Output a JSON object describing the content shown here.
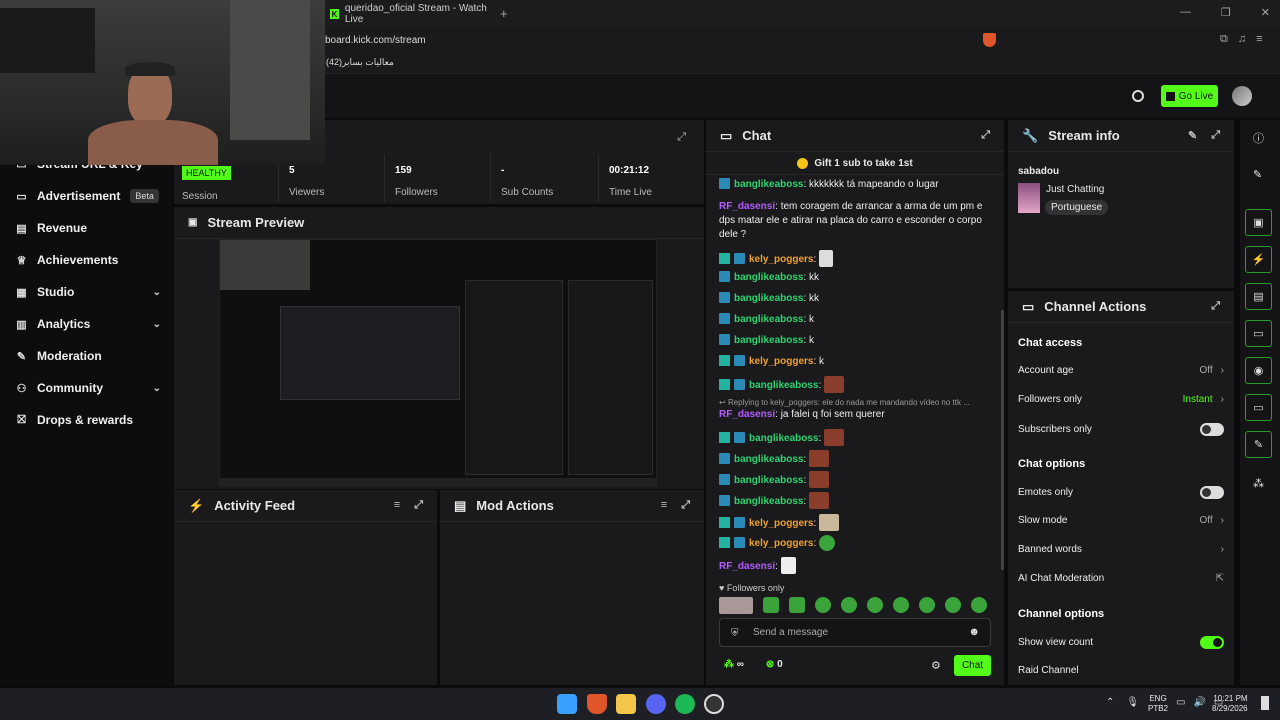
{
  "browser": {
    "tab_title": "queridao_oficial Stream - Watch Live",
    "url": "board.kick.com/stream",
    "bookmark": "معالیات بسابر(42)"
  },
  "header": {
    "go_live": "Go Live"
  },
  "sidebar": {
    "items": [
      {
        "label": "Stream URL & Key"
      },
      {
        "label": "Advertisement",
        "badge": "Beta"
      },
      {
        "label": "Revenue"
      },
      {
        "label": "Achievements"
      },
      {
        "label": "Studio"
      },
      {
        "label": "Analytics"
      },
      {
        "label": "Moderation"
      },
      {
        "label": "Community"
      },
      {
        "label": "Drops & rewards"
      }
    ]
  },
  "stats": {
    "health": "HEALTHY",
    "session_label": "Session",
    "viewers": "5",
    "viewers_label": "Viewers",
    "followers": "159",
    "followers_label": "Followers",
    "subs": "-",
    "subs_label": "Sub Counts",
    "time": "00:21:12",
    "time_label": "Time Live"
  },
  "preview": {
    "title": "Stream Preview"
  },
  "activity": {
    "title": "Activity Feed"
  },
  "mod": {
    "title": "Mod Actions"
  },
  "chat": {
    "title": "Chat",
    "gift_banner": "Gift 1 sub to take 1st",
    "messages": [
      {
        "user": "banglikeaboss",
        "text": "kkkkkkk tá mapeando o lugar"
      },
      {
        "user": "RF_dasensi",
        "text": "tem coragem de arrancar a arma de um pm e dps matar ele e atirar na placa do carro e esconder o corpo dele ?"
      },
      {
        "user": "kely_poggers",
        "text": ""
      },
      {
        "user": "banglikeaboss",
        "text": "kk"
      },
      {
        "user": "banglikeaboss",
        "text": "kk"
      },
      {
        "user": "banglikeaboss",
        "text": "k"
      },
      {
        "user": "banglikeaboss",
        "text": "k"
      },
      {
        "user": "kely_poggers",
        "text": "k"
      },
      {
        "user": "banglikeaboss",
        "text": ""
      },
      {
        "user": "RF_dasensi",
        "text": "ja falei q foi sem querer",
        "reply": "Replying to kely_poggers: ele do nada me mandando vídeo no ttk ..."
      },
      {
        "user": "banglikeaboss",
        "text": ""
      },
      {
        "user": "banglikeaboss",
        "text": ""
      },
      {
        "user": "banglikeaboss",
        "text": ""
      },
      {
        "user": "banglikeaboss",
        "text": ""
      },
      {
        "user": "kely_poggers",
        "text": ""
      },
      {
        "user": "kely_poggers",
        "text": ""
      },
      {
        "user": "RF_dasensi",
        "text": ""
      }
    ],
    "followers_only": "Followers only",
    "input_placeholder": "Send a message",
    "points": "∞",
    "count": "0",
    "send": "Chat"
  },
  "stream_info": {
    "title": "Stream info",
    "stream_title": "sabadou",
    "category": "Just Chatting",
    "language": "Portuguese"
  },
  "channel_actions": {
    "title": "Channel Actions",
    "chat_access": "Chat access",
    "account_age": "Account age",
    "account_age_val": "Off",
    "followers_only": "Followers only",
    "followers_only_val": "Instant",
    "subscribers_only": "Subscribers only",
    "chat_options": "Chat options",
    "emotes_only": "Emotes only",
    "slow_mode": "Slow mode",
    "slow_mode_val": "Off",
    "banned_words": "Banned words",
    "ai_mod": "AI Chat Moderation",
    "channel_options": "Channel options",
    "show_view_count": "Show view count",
    "raid_channel": "Raid Channel"
  },
  "taskbar": {
    "lang": "ENG",
    "layout": "PTB2",
    "time": "10:21 PM",
    "date": "8/29/2026"
  },
  "colors": {
    "accent": "#53fc18",
    "panel": "#1a1a1d"
  }
}
